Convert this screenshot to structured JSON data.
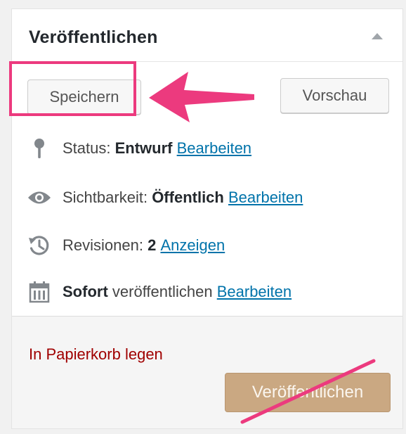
{
  "box": {
    "title": "Veröffentlichen",
    "toggle_icon": "triangle-up-icon"
  },
  "actions": {
    "save_label": "Speichern",
    "preview_label": "Vorschau"
  },
  "status": {
    "label": "Status:",
    "value": "Entwurf",
    "edit": "Bearbeiten",
    "icon": "pin-icon"
  },
  "visibility": {
    "label": "Sichtbarkeit:",
    "value": "Öffentlich",
    "edit": "Bearbeiten",
    "icon": "eye-icon"
  },
  "revisions": {
    "label": "Revisionen:",
    "value": "2",
    "link": "Anzeigen",
    "icon": "history-icon"
  },
  "schedule": {
    "value": "Sofort",
    "label": "veröffentlichen",
    "edit": "Bearbeiten",
    "icon": "calendar-icon"
  },
  "major": {
    "trash_label": "In Papierkorb legen",
    "publish_label": "Veröffentlichen"
  },
  "colors": {
    "annotation": "#ec3a7e",
    "link": "#0073aa",
    "trash": "#a00000",
    "publish_disabled": "#caa882"
  }
}
